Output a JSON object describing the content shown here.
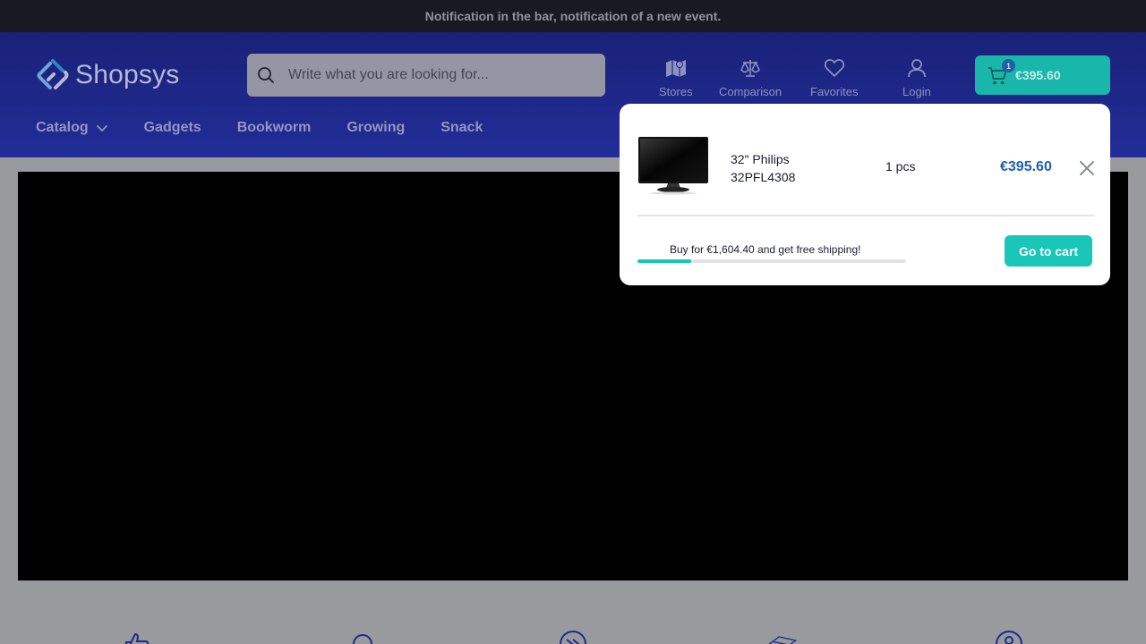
{
  "notification": {
    "text": "Notification in the bar, notification of a new event."
  },
  "header": {
    "logo_text": "Shopsys",
    "search": {
      "placeholder": "Write what you are looking for...",
      "value": ""
    },
    "links": [
      {
        "label": "Stores",
        "icon": "map-icon"
      },
      {
        "label": "Comparison",
        "icon": "scales-icon"
      },
      {
        "label": "Favorites",
        "icon": "heart-icon"
      },
      {
        "label": "Login",
        "icon": "user-icon"
      }
    ],
    "cart": {
      "count": "1",
      "total": "€395.60",
      "icon": "cart-icon"
    }
  },
  "nav": {
    "items": [
      {
        "label": "Catalog",
        "has_dropdown": true
      },
      {
        "label": "Gadgets"
      },
      {
        "label": "Bookworm"
      },
      {
        "label": "Growing"
      },
      {
        "label": "Snack"
      }
    ]
  },
  "cart_dropdown": {
    "item": {
      "name": "32\" Philips 32PFL4308",
      "quantity": "1 pcs",
      "price": "€395.60",
      "image": "tv-monitor"
    },
    "shipping_text": "Buy for €1,604.40 and get free shipping!",
    "shipping_progress": 0.2,
    "go_to_cart_label": "Go to cart"
  },
  "colors": {
    "header": "#1a2178",
    "accent": "#19c6b8",
    "price": "#1f5fb5",
    "notification_bar": "#171a22"
  },
  "benefits": {
    "icons": [
      "thumbs-up-icon",
      "search-icon",
      "fast-forward-icon",
      "card-icon",
      "location-pin-icon"
    ]
  }
}
